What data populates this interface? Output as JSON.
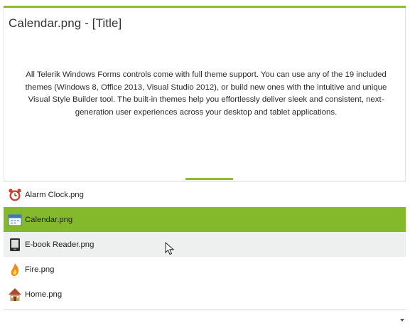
{
  "preview": {
    "title": "Calendar.png - [Title]",
    "description": "All Telerik Windows Forms controls come with full theme support. You can use any of the 19 included themes (Windows 8, Office 2013, Visual Studio 2012), or build new ones with the intuitive and unique Visual Style Builder tool. The built-in themes help you effortlessly deliver sleek and consistent, next-generation user experiences across your desktop and tablet applications."
  },
  "list": {
    "items": [
      {
        "label": "Alarm Clock.png",
        "icon": "alarm-clock-icon",
        "state": "normal"
      },
      {
        "label": "Calendar.png",
        "icon": "calendar-icon",
        "state": "selected"
      },
      {
        "label": "E-book Reader.png",
        "icon": "ebook-reader-icon",
        "state": "hover"
      },
      {
        "label": "Fire.png",
        "icon": "fire-icon",
        "state": "normal"
      },
      {
        "label": "Home.png",
        "icon": "home-icon",
        "state": "normal"
      }
    ]
  },
  "colors": {
    "accent": "#8dbd2e",
    "selected_row": "#84b92b",
    "hover_row": "#eef0f0"
  }
}
